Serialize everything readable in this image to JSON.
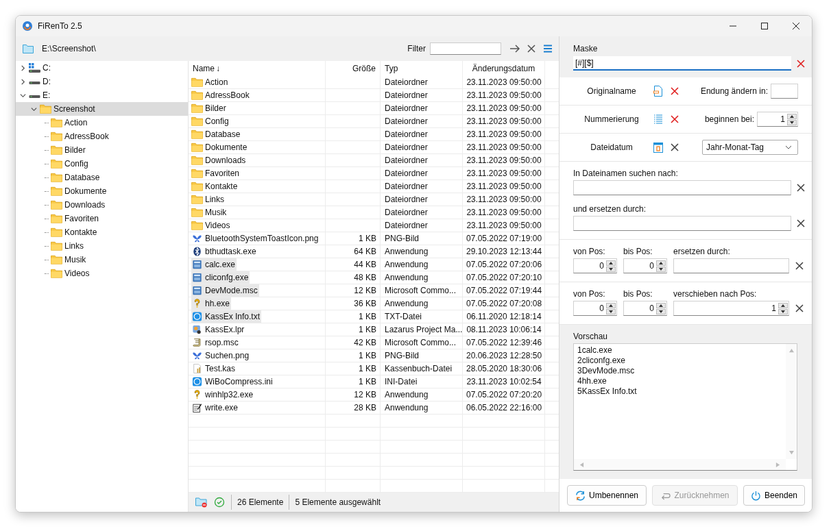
{
  "window": {
    "title": "FiRenTo 2.5"
  },
  "path_bar": {
    "path": "E:\\Screenshot\\",
    "filter_label": "Filter"
  },
  "tree": [
    {
      "label": "C:",
      "kind": "system-drive",
      "expandable": true,
      "expanded": false,
      "selected": false
    },
    {
      "label": "D:",
      "kind": "drive",
      "expandable": true,
      "expanded": false,
      "selected": false
    },
    {
      "label": "E:",
      "kind": "drive",
      "expandable": true,
      "expanded": true,
      "selected": false,
      "children": [
        {
          "label": "Screenshot",
          "kind": "folder",
          "expandable": true,
          "expanded": true,
          "selected": true,
          "children": [
            {
              "label": "Action",
              "kind": "folder",
              "expandable": false,
              "expanded": false,
              "selected": false
            },
            {
              "label": "AdressBook",
              "kind": "folder",
              "expandable": false,
              "expanded": false,
              "selected": false
            },
            {
              "label": "Bilder",
              "kind": "folder",
              "expandable": false,
              "expanded": false,
              "selected": false
            },
            {
              "label": "Config",
              "kind": "folder",
              "expandable": false,
              "expanded": false,
              "selected": false
            },
            {
              "label": "Database",
              "kind": "folder",
              "expandable": false,
              "expanded": false,
              "selected": false
            },
            {
              "label": "Dokumente",
              "kind": "folder",
              "expandable": false,
              "expanded": false,
              "selected": false
            },
            {
              "label": "Downloads",
              "kind": "folder",
              "expandable": false,
              "expanded": false,
              "selected": false
            },
            {
              "label": "Favoriten",
              "kind": "folder",
              "expandable": false,
              "expanded": false,
              "selected": false
            },
            {
              "label": "Kontakte",
              "kind": "folder",
              "expandable": false,
              "expanded": false,
              "selected": false
            },
            {
              "label": "Links",
              "kind": "folder",
              "expandable": false,
              "expanded": false,
              "selected": false
            },
            {
              "label": "Musik",
              "kind": "folder",
              "expandable": false,
              "expanded": false,
              "selected": false
            },
            {
              "label": "Videos",
              "kind": "folder",
              "expandable": false,
              "expanded": false,
              "selected": false
            }
          ]
        }
      ]
    }
  ],
  "file_list": {
    "columns": [
      {
        "label": "Name",
        "sort_indicator": "↓"
      },
      {
        "label": "Größe"
      },
      {
        "label": "Typ"
      },
      {
        "label": "Änderungsdatum"
      }
    ],
    "rows": [
      {
        "name": "Action",
        "type": "Dateiordner",
        "date": "23.11.2023 09:50:00",
        "kind": "folder",
        "selected": false
      },
      {
        "name": "AdressBook",
        "type": "Dateiordner",
        "date": "23.11.2023 09:50:00",
        "kind": "folder",
        "selected": false
      },
      {
        "name": "Bilder",
        "type": "Dateiordner",
        "date": "23.11.2023 09:50:00",
        "kind": "folder",
        "selected": false
      },
      {
        "name": "Config",
        "type": "Dateiordner",
        "date": "23.11.2023 09:50:00",
        "kind": "folder",
        "selected": false
      },
      {
        "name": "Database",
        "type": "Dateiordner",
        "date": "23.11.2023 09:50:00",
        "kind": "folder",
        "selected": false
      },
      {
        "name": "Dokumente",
        "type": "Dateiordner",
        "date": "23.11.2023 09:50:00",
        "kind": "folder",
        "selected": false
      },
      {
        "name": "Downloads",
        "type": "Dateiordner",
        "date": "23.11.2023 09:50:00",
        "kind": "folder",
        "selected": false
      },
      {
        "name": "Favoriten",
        "type": "Dateiordner",
        "date": "23.11.2023 09:50:00",
        "kind": "folder",
        "selected": false
      },
      {
        "name": "Kontakte",
        "type": "Dateiordner",
        "date": "23.11.2023 09:50:00",
        "kind": "folder",
        "selected": false
      },
      {
        "name": "Links",
        "type": "Dateiordner",
        "date": "23.11.2023 09:50:00",
        "kind": "folder",
        "selected": false
      },
      {
        "name": "Musik",
        "type": "Dateiordner",
        "date": "23.11.2023 09:50:00",
        "kind": "folder",
        "selected": false
      },
      {
        "name": "Videos",
        "type": "Dateiordner",
        "date": "23.11.2023 09:50:00",
        "kind": "folder",
        "selected": false
      },
      {
        "name": "BluetoothSystemToastIcon.png",
        "size": "1 KB",
        "type": "PNG-Bild",
        "date": "07.05.2022 07:19:00",
        "kind": "image",
        "selected": false
      },
      {
        "name": "bthudtask.exe",
        "size": "64 KB",
        "type": "Anwendung",
        "date": "29.10.2023 12:13:44",
        "kind": "bluetooth",
        "selected": false
      },
      {
        "name": "calc.exe",
        "size": "44 KB",
        "type": "Anwendung",
        "date": "07.05.2022 07:20:06",
        "kind": "app",
        "selected": true
      },
      {
        "name": "cliconfg.exe",
        "size": "48 KB",
        "type": "Anwendung",
        "date": "07.05.2022 07:20:10",
        "kind": "app",
        "selected": true
      },
      {
        "name": "DevMode.msc",
        "size": "12 KB",
        "type": "Microsoft Commo...",
        "date": "07.05.2022 07:19:44",
        "kind": "app",
        "selected": true
      },
      {
        "name": "hh.exe",
        "size": "36 KB",
        "type": "Anwendung",
        "date": "07.05.2022 07:20:08",
        "kind": "help",
        "selected": true
      },
      {
        "name": "KassEx Info.txt",
        "size": "1 KB",
        "type": "TXT-Datei",
        "date": "06.11.2020 12:18:14",
        "kind": "circle",
        "selected": true
      },
      {
        "name": "KassEx.lpr",
        "size": "1 KB",
        "type": "Lazarus Project Ma...",
        "date": "08.11.2023 10:06:14",
        "kind": "project",
        "selected": false
      },
      {
        "name": "rsop.msc",
        "size": "42 KB",
        "type": "Microsoft Commo...",
        "date": "07.05.2022 12:39:46",
        "kind": "scroll",
        "selected": false
      },
      {
        "name": "Suchen.png",
        "size": "1 KB",
        "type": "PNG-Bild",
        "date": "20.06.2023 12:28:50",
        "kind": "image",
        "selected": false
      },
      {
        "name": "Test.kas",
        "size": "1 KB",
        "type": "Kassenbuch-Datei",
        "date": "28.05.2020 18:30:06",
        "kind": "document",
        "selected": false
      },
      {
        "name": "WiBoCompress.ini",
        "size": "1 KB",
        "type": "INI-Datei",
        "date": "23.11.2023 10:02:54",
        "kind": "circle",
        "selected": false
      },
      {
        "name": "winhlp32.exe",
        "size": "12 KB",
        "type": "Anwendung",
        "date": "07.05.2022 07:20:20",
        "kind": "help",
        "selected": false
      },
      {
        "name": "write.exe",
        "size": "28 KB",
        "type": "Anwendung",
        "date": "06.05.2022 22:16:00",
        "kind": "notepad",
        "selected": false
      }
    ]
  },
  "status_bar": {
    "count": "26 Elemente",
    "selection": "5 Elemente ausgewählt"
  },
  "mask": {
    "label": "Maske",
    "value": "[#][$]"
  },
  "options": [
    {
      "label": "Originalname",
      "kind": "text",
      "active": true,
      "field_label": "Endung ändern in:"
    },
    {
      "label": "Nummerierung",
      "kind": "spinner",
      "active": true,
      "field_label": "beginnen bei:",
      "value": "1"
    },
    {
      "label": "Dateidatum",
      "kind": "dropdown",
      "active": false,
      "value": "Jahr-Monat-Tag"
    }
  ],
  "search_replace": {
    "search_label": "In Dateinamen suchen nach:",
    "replace_label": "und ersetzen durch:"
  },
  "position_rows": [
    {
      "kind": "text",
      "from_label": "von Pos:",
      "from_value": "0",
      "to_label": "bis Pos:",
      "to_value": "0",
      "target_label": "ersetzen durch:"
    },
    {
      "kind": "spinner",
      "from_label": "von Pos:",
      "from_value": "0",
      "to_label": "bis Pos:",
      "to_value": "0",
      "target_label": "verschieben nach Pos:",
      "target_value": "1"
    }
  ],
  "preview": {
    "label": "Vorschau",
    "lines": [
      "1calc.exe",
      "2cliconfg.exe",
      "3DevMode.msc",
      "4hh.exe",
      "5KassEx Info.txt"
    ]
  },
  "buttons": [
    {
      "label": "Umbenennen",
      "kind": "rename",
      "disabled": false
    },
    {
      "label": "Zurücknehmen",
      "kind": "undo",
      "disabled": true
    },
    {
      "label": "Beenden",
      "kind": "exit",
      "disabled": false
    }
  ]
}
